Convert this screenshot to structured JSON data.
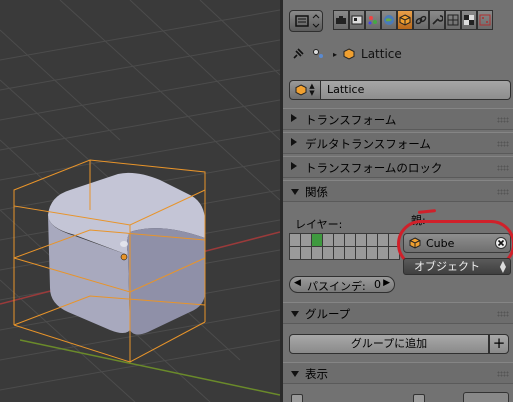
{
  "viewport": {
    "colors": {
      "background": "#3a3a3a",
      "grid": "#4a4a4a",
      "lattice": "#e8942a",
      "cube": "#a9aac0",
      "x_axis": "#9a3a3a",
      "y_axis": "#6a8a2a"
    }
  },
  "panel": {
    "breadcrumb": {
      "object_name": "Lattice"
    },
    "object_name_field": {
      "value": "Lattice"
    },
    "sections": {
      "transform": "トランスフォーム",
      "delta_transform": "デルタトランスフォーム",
      "transform_lock": "トランスフォームのロック",
      "relations": "関係",
      "groups": "グループ",
      "display": "表示"
    },
    "relations": {
      "layers_label": "レイヤー:",
      "parent_label": "親:",
      "parent_value": "Cube",
      "parent_type": "オブジェクト",
      "pass_index_label": "パスインデ:",
      "pass_index_value": "0"
    },
    "groups": {
      "add_label": "グループに追加",
      "plus": "+"
    },
    "colors": {
      "panel_bg": "#727272",
      "active_tab": "#e8a04a",
      "highlight_ring": "#d0202a",
      "layer_active": "#3f9a3f"
    }
  }
}
